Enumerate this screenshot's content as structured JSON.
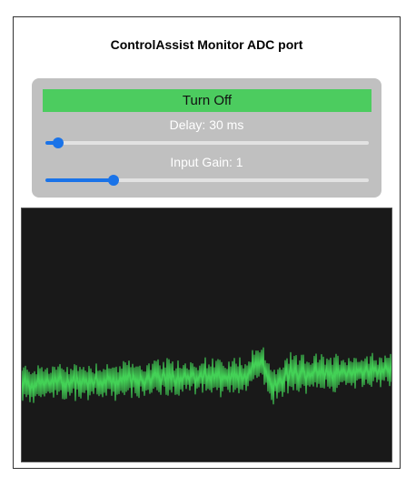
{
  "header": {
    "title": "ControlAssist Monitor ADC port"
  },
  "controls": {
    "toggle_label": "Turn Off",
    "toggle_color": "#4ccc5f",
    "delay": {
      "label": "Delay: 30 ms",
      "value": 30,
      "position_fraction": 0.04
    },
    "gain": {
      "label": "Input Gain: 1",
      "value": 1,
      "position_fraction": 0.21
    },
    "slider_accent": "#1a73e8"
  },
  "scope": {
    "background": "#191919",
    "trace_color": "#43d156"
  }
}
